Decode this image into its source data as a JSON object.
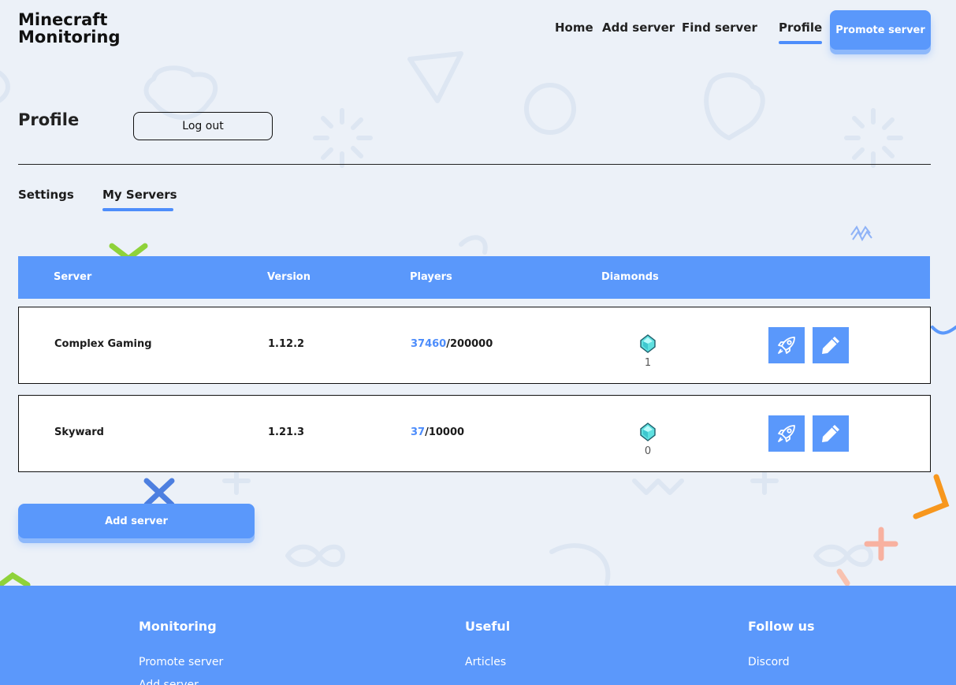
{
  "header": {
    "logo_line1": "Minecraft",
    "logo_line2": "Monitoring",
    "nav": {
      "home": "Home",
      "add_server": "Add server",
      "find_server": "Find server",
      "profile": "Profile"
    },
    "promote_label": "Promote server"
  },
  "profile": {
    "title": "Profile",
    "logout_label": "Log out",
    "tabs": {
      "settings": "Settings",
      "my_servers": "My Servers",
      "active": "My Servers"
    }
  },
  "table": {
    "headers": {
      "server": "Server",
      "version": "Version",
      "players": "Players",
      "diamonds": "Diamonds"
    },
    "rows": [
      {
        "server": "Complex Gaming",
        "version": "1.12.2",
        "players_online": "37460",
        "players_max": "/200000",
        "diamonds": "1"
      },
      {
        "server": "Skyward",
        "version": "1.21.3",
        "players_online": "37",
        "players_max": "/10000",
        "diamonds": "0"
      }
    ],
    "action_icons": [
      "rocket-icon",
      "pencil-icon"
    ]
  },
  "add_server_label": "Add server",
  "footer": {
    "columns": [
      {
        "title": "Monitoring",
        "links": [
          "Promote server",
          "Add server"
        ]
      },
      {
        "title": "Useful",
        "links": [
          "Articles"
        ]
      },
      {
        "title": "Follow us",
        "links": [
          "Discord"
        ]
      }
    ]
  },
  "colors": {
    "accent": "#5a98fb",
    "accent_dark": "#4d8dfb",
    "background": "#ecf1f8",
    "diamond": "#5fe0e0"
  }
}
